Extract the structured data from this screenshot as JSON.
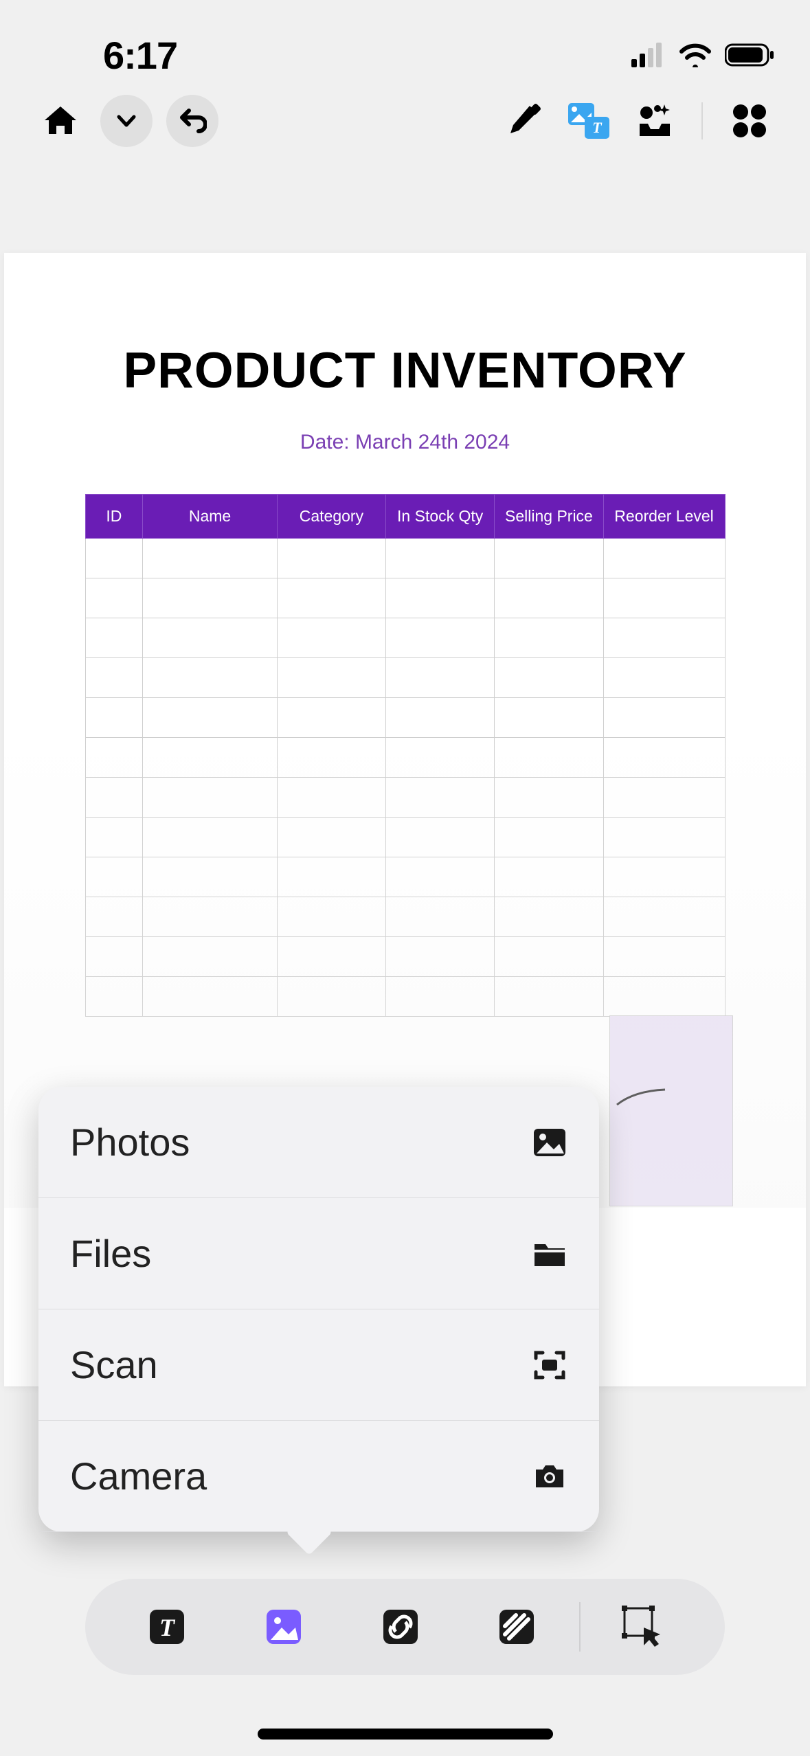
{
  "status": {
    "time": "6:17"
  },
  "document": {
    "title": "PRODUCT INVENTORY",
    "date": "Date: March 24th 2024",
    "columns": [
      "ID",
      "Name",
      "Category",
      "In Stock Qty",
      "Selling Price",
      "Reorder Level"
    ]
  },
  "popup": {
    "items": [
      {
        "label": "Photos",
        "icon": "photo"
      },
      {
        "label": "Files",
        "icon": "folder"
      },
      {
        "label": "Scan",
        "icon": "scan"
      },
      {
        "label": "Camera",
        "icon": "camera"
      }
    ]
  }
}
